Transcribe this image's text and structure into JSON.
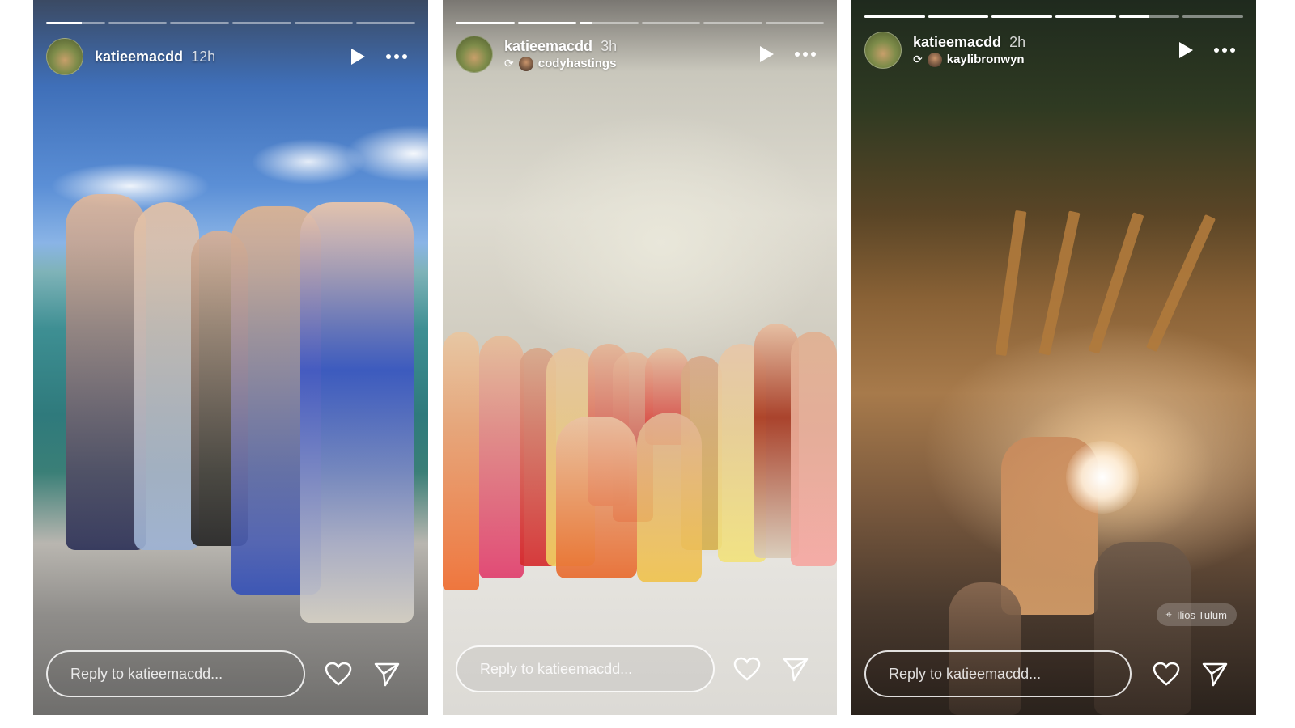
{
  "stories": [
    {
      "username": "katieemacdd",
      "time": "12h",
      "repost_user": "",
      "progress": {
        "segments": 6,
        "current": 1,
        "current_fill": 0.6
      },
      "reply_placeholder": "Reply to katieemacdd...",
      "location": ""
    },
    {
      "username": "katieemacdd",
      "time": "3h",
      "repost_user": "codyhastings",
      "progress": {
        "segments": 6,
        "current": 3,
        "current_fill": 0.2
      },
      "reply_placeholder": "Reply to katieemacdd...",
      "location": ""
    },
    {
      "username": "katieemacdd",
      "time": "2h",
      "repost_user": "kaylibronwyn",
      "progress": {
        "segments": 6,
        "current": 5,
        "current_fill": 0.5
      },
      "reply_placeholder": "Reply to katieemacdd...",
      "location": "Ilios Tulum"
    }
  ],
  "icons": {
    "play": "play-icon",
    "more": "more-options-icon",
    "repost": "repost-icon",
    "like": "heart-icon",
    "share": "send-icon",
    "location": "location-pin-icon"
  },
  "colors": {
    "text": "#ffffff"
  }
}
